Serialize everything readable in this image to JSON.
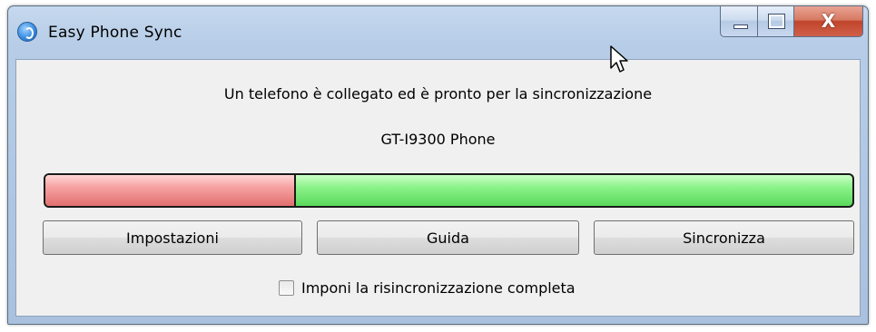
{
  "window": {
    "title": "Easy Phone Sync",
    "icon": "sync-app-icon",
    "controls": {
      "minimize": "minimize-icon",
      "maximize": "maximize-icon",
      "close_glyph": "X"
    }
  },
  "status": {
    "message": "Un telefono è collegato ed è pronto per la sincronizzazione",
    "device": "GT-I9300 Phone"
  },
  "progress": {
    "fraction": 0.31,
    "colors": {
      "filled": "#f08a8a",
      "remaining": "#7ee87c"
    }
  },
  "buttons": {
    "settings": "Impostazioni",
    "help": "Guida",
    "sync": "Sincronizza"
  },
  "options": {
    "force_full_resync": {
      "label": "Imponi la risincronizzazione completa",
      "checked": false
    }
  }
}
